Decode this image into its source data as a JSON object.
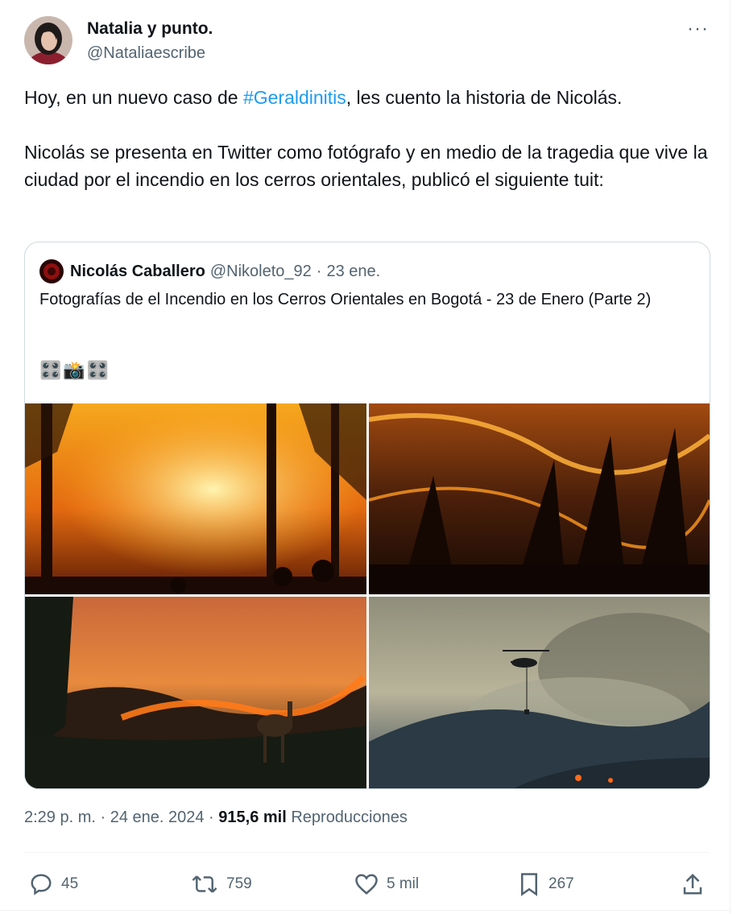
{
  "author": {
    "name": "Natalia y punto.",
    "handle": "@Nataliaescribe"
  },
  "more_label": "···",
  "tweet_text": {
    "p1_before": "Hoy, en un nuevo caso de ",
    "p1_hashtag": "#Geraldinitis",
    "p1_after": ", les cuento la historia de Nicolás.",
    "p2": "Nicolás se presenta en Twitter como fotógrafo y en medio de la tragedia que vive la ciudad por el incendio en los cerros orientales, publicó el siguiente tuit:"
  },
  "quoted": {
    "name": "Nicolás Caballero",
    "handle": "@Nikoleto_92",
    "separator": "·",
    "date": "23 ene.",
    "text": "Fotografías de el Incendio en los Cerros Orientales en Bogotá - 23 de Enero (Parte 2)",
    "emojis": "🎛️📸🎛️"
  },
  "meta": {
    "time": "2:29 p. m. · 24 ene. 2024 · ",
    "views": "915,6 mil",
    "views_label": " Reproducciones"
  },
  "actions": {
    "replies": "45",
    "retweets": "759",
    "likes": "5 mil",
    "bookmarks": "267"
  },
  "colors": {
    "link": "#1d9bf0",
    "secondary": "#536471",
    "primary": "#0f1419",
    "border": "#cfd9de"
  }
}
